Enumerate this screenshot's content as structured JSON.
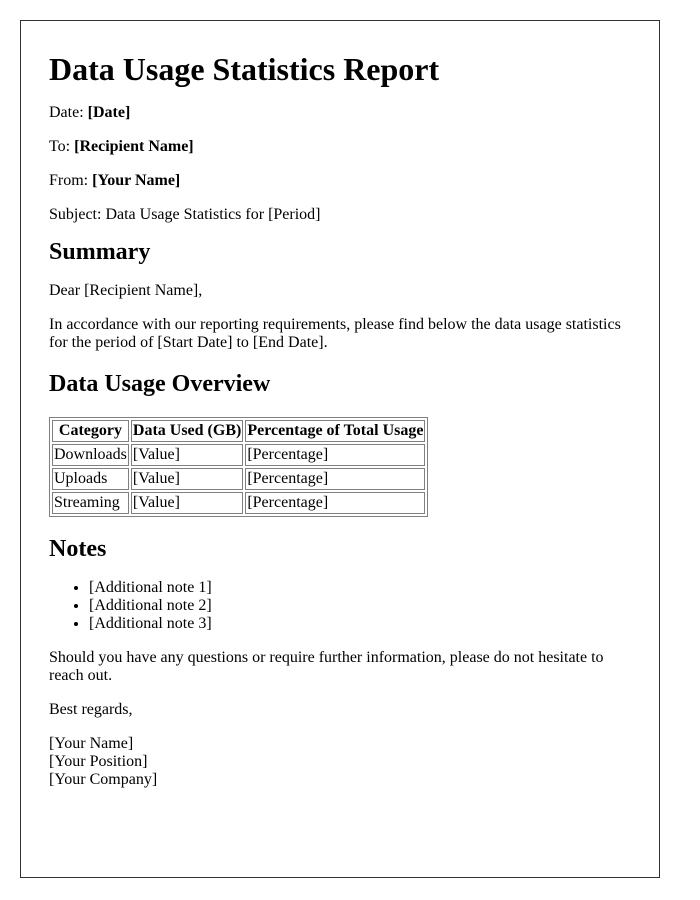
{
  "document": {
    "title": "Data Usage Statistics Report",
    "meta": [
      {
        "label": "Date: ",
        "value": "[Date]"
      },
      {
        "label": "To: ",
        "value": "[Recipient Name]"
      },
      {
        "label": "From: ",
        "value": "[Your Name]"
      }
    ],
    "subject": "Subject: Data Usage Statistics for [Period]",
    "summary": {
      "heading": "Summary",
      "greeting": "Dear [Recipient Name],",
      "intro": "In accordance with our reporting requirements, please find below the data usage statistics for the period of [Start Date] to [End Date]."
    },
    "overview": {
      "heading": "Data Usage Overview",
      "table": {
        "headers": [
          "Category",
          "Data Used (GB)",
          "Percentage of Total Usage"
        ],
        "rows": [
          [
            "Downloads",
            "[Value]",
            "[Percentage]"
          ],
          [
            "Uploads",
            "[Value]",
            "[Percentage]"
          ],
          [
            "Streaming",
            "[Value]",
            "[Percentage]"
          ]
        ]
      }
    },
    "notes": {
      "heading": "Notes",
      "items": [
        "[Additional note 1]",
        "[Additional note 2]",
        "[Additional note 3]"
      ]
    },
    "closing": "Should you have any questions or require further information, please do not hesitate to reach out.",
    "regards": "Best regards,",
    "signature": [
      "[Your Name]",
      "[Your Position]",
      "[Your Company]"
    ]
  }
}
